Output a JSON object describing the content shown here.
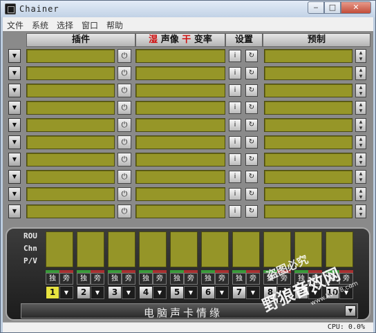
{
  "window": {
    "title": "Chainer",
    "min_glyph": "‒",
    "max_glyph": "□",
    "close_glyph": "✕"
  },
  "menu": [
    "文件",
    "系统",
    "选择",
    "窗口",
    "帮助"
  ],
  "columns": {
    "plugin": "插件",
    "wet": "湿",
    "sound_image": "声像",
    "dry": "干",
    "pitch": "变率",
    "settings": "设置",
    "preset": "预制"
  },
  "rack": {
    "row_count": 10,
    "power_glyph": "⏻",
    "info_glyph": "i",
    "edit_glyph": "↻",
    "drop_glyph": "▼",
    "spin_up": "▲",
    "spin_down": "▼"
  },
  "mixer": {
    "labels": [
      "ROU",
      "Chn",
      "P/V"
    ],
    "solo_label": "独",
    "side_label": "旁",
    "channels": [
      "1",
      "2",
      "3",
      "4",
      "5",
      "6",
      "7",
      "8",
      "9",
      "10"
    ],
    "selected_channel": "1",
    "bottom_title": "电脑声卡情缘",
    "drop_glyph": "▼"
  },
  "status": {
    "cpu": "CPU: 0.0%"
  },
  "watermark": {
    "line1": "盗图必究",
    "line2": "野狼音效网",
    "line3": "www.kv778.com"
  },
  "colors": {
    "lcd": "#969628",
    "selected": "#e8e440",
    "solo_cap": "#3a9a3a",
    "side_cap": "#a83030"
  }
}
